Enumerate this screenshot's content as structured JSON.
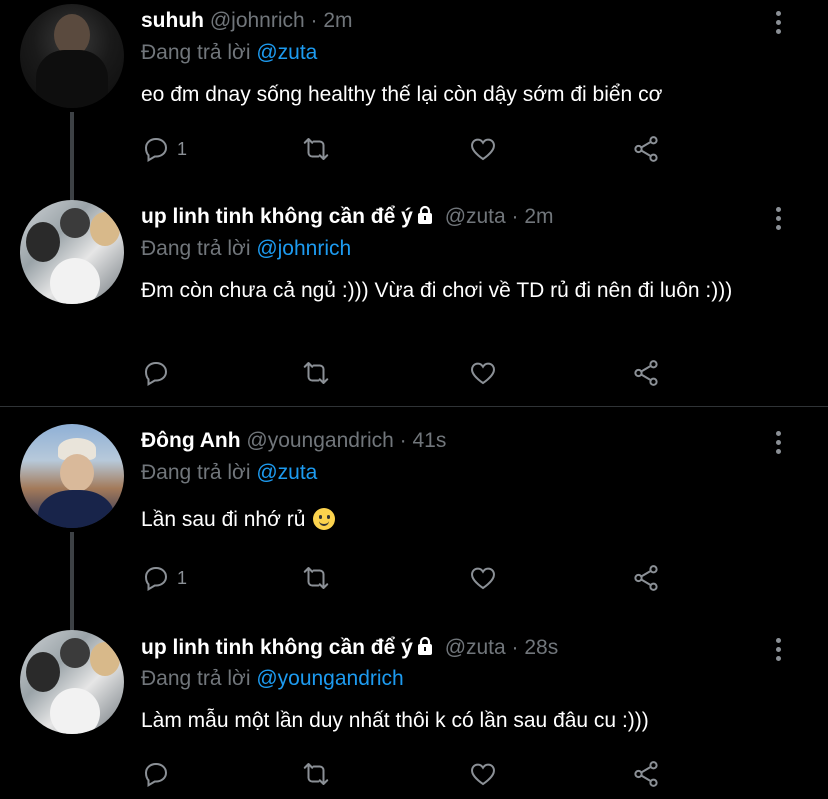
{
  "reply_prefix": "Đang trả lời",
  "tweets": [
    {
      "name": "suhuh",
      "handle": "@johnrich",
      "time": "· 2m",
      "reply_to": "@zuta",
      "text": "eo đm dnay sống healthy thế lại còn dậy sớm đi biển cơ",
      "reply_count": "1",
      "locked": false,
      "avatar": "dark-portrait"
    },
    {
      "name": "up linh tinh không cần để ý",
      "handle": "@zuta",
      "time": "· 2m",
      "reply_to": "@johnrich",
      "text": "Đm còn chưa cả ngủ :))) Vừa đi chơi về TD rủ đi nên đi luôn :)))",
      "reply_count": "",
      "locked": true,
      "avatar": "group-photo"
    },
    {
      "name": "Đông Anh",
      "handle": "@youngandrich",
      "time": "· 41s",
      "reply_to": "@zuta",
      "text": "Lần sau đi nhớ rủ",
      "emoji": "slightly-smiling-face",
      "reply_count": "1",
      "locked": false,
      "avatar": "cap-portrait"
    },
    {
      "name": "up linh tinh không cần để ý",
      "handle": "@zuta",
      "time": "· 28s",
      "reply_to": "@youngandrich",
      "text": "Làm mẫu một lần duy nhất thôi k có lần sau đâu cu :)))",
      "reply_count": "",
      "locked": true,
      "avatar": "group-photo"
    }
  ],
  "colors": {
    "background": "#000000",
    "mention": "#1d9bf0",
    "secondary_text": "#71767b",
    "thread_line": "#3d4145"
  }
}
